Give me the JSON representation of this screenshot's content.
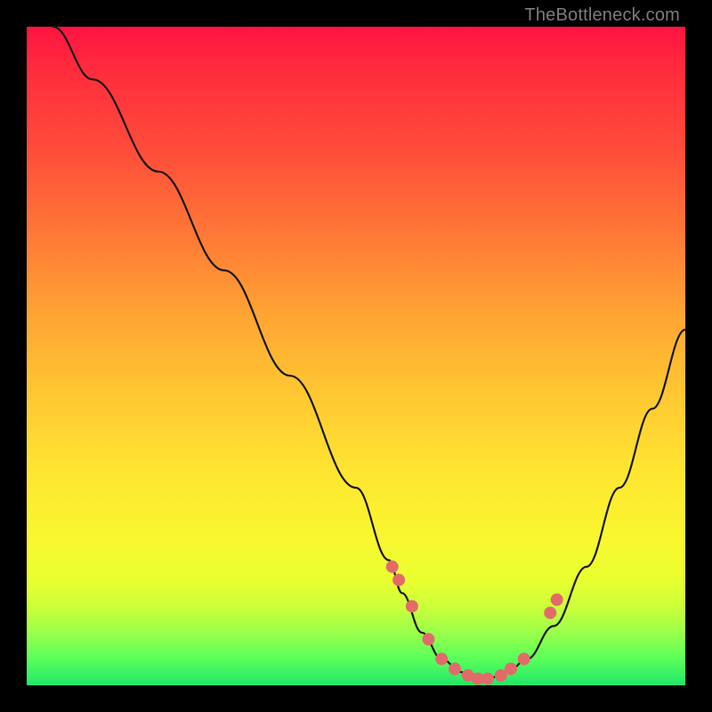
{
  "watermark": "TheBottleneck.com",
  "colors": {
    "curve": "#181818",
    "dots": "#e36a6a",
    "background_top": "#ff1440",
    "background_bottom": "#22e76a",
    "frame": "#000000"
  },
  "chart_data": {
    "type": "line",
    "title": "",
    "xlabel": "",
    "ylabel": "",
    "xlim": [
      0,
      100
    ],
    "ylim": [
      0,
      100
    ],
    "grid": false,
    "legend": false,
    "series": [
      {
        "name": "bottleneck-curve",
        "x": [
          4,
          10,
          20,
          30,
          40,
          50,
          55,
          57,
          60,
          63,
          66,
          68,
          70,
          73,
          76,
          80,
          85,
          90,
          95,
          100
        ],
        "y": [
          100,
          92,
          78,
          63,
          47,
          30,
          19,
          14,
          8,
          4,
          2,
          1,
          1,
          2,
          4,
          9,
          18,
          30,
          42,
          54
        ]
      }
    ],
    "markers": {
      "name": "highlight-dots",
      "x": [
        55.5,
        56.5,
        58.5,
        61,
        63,
        65,
        67,
        68.5,
        70,
        72,
        73.5,
        75.5,
        79.5,
        80.5
      ],
      "y": [
        18,
        16,
        12,
        7,
        4,
        2.5,
        1.5,
        1,
        1,
        1.5,
        2.5,
        4,
        11,
        13
      ]
    }
  }
}
